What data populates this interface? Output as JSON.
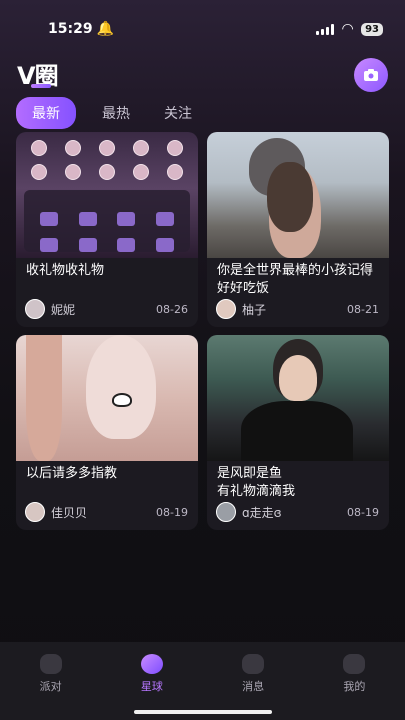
{
  "status": {
    "time": "15:29",
    "battery": "93"
  },
  "header": {
    "logo": "V圈"
  },
  "tabs": [
    {
      "label": "最新"
    },
    {
      "label": "最热"
    },
    {
      "label": "关注"
    }
  ],
  "posts": [
    {
      "title": "收礼物收礼物",
      "author": "妮妮",
      "date": "08-26"
    },
    {
      "title": "你是全世界最棒的小孩记得好好吃饭",
      "author": "柚子",
      "date": "08-21"
    },
    {
      "title": "以后请多多指教",
      "author": "佳贝贝",
      "date": "08-19"
    },
    {
      "title": "是风即是鱼\n有礼物滴滴我",
      "author": "ɑ走走ɞ",
      "date": "08-19"
    }
  ],
  "nav": [
    {
      "label": "派对"
    },
    {
      "label": "星球"
    },
    {
      "label": "消息"
    },
    {
      "label": "我的"
    }
  ],
  "colors": {
    "accent": "#9a5cff",
    "nav_active": "#b777ff"
  }
}
